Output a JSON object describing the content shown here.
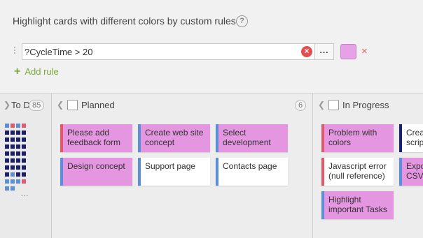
{
  "rules_panel": {
    "title": "Highlight cards with different colors by custom rules",
    "help_glyph": "?",
    "rule": {
      "expression": "?CycleTime > 20",
      "clear_glyph": "×",
      "more_label": "...",
      "swatch_color": "#e7a1e7",
      "remove_glyph": "×"
    },
    "add_rule_plus": "+",
    "add_rule_label": "Add rule"
  },
  "colors": {
    "card_highlight": "#e496e0",
    "card_plain": "#ffffff",
    "bar_blue": "#5b8fd8",
    "bar_red": "#e05a6a",
    "bar_navy": "#1b1f6b",
    "add_green": "#7aaa3a"
  },
  "board": {
    "columns": [
      {
        "id": "todo",
        "title": "To D",
        "count": "85",
        "collapsed": true,
        "more_label": "..."
      },
      {
        "id": "planned",
        "title": "Planned",
        "count": "6",
        "cards": [
          {
            "text": "Please add feedback form",
            "highlight": true,
            "bar": "red"
          },
          {
            "text": "Create web site concept",
            "highlight": true,
            "bar": "blue"
          },
          {
            "text": "Select development",
            "highlight": true,
            "bar": "blue"
          },
          {
            "text": "Design concept",
            "highlight": true,
            "bar": "blue"
          },
          {
            "text": "Support page",
            "highlight": false,
            "bar": "blue"
          },
          {
            "text": "Contacts page",
            "highlight": false,
            "bar": "blue"
          }
        ]
      },
      {
        "id": "in-progress",
        "title": "In Progress",
        "cards": [
          {
            "text": "Problem with colors",
            "highlight": true,
            "bar": "red"
          },
          {
            "text": "Creat script",
            "highlight": false,
            "bar": "navy"
          },
          {
            "text": "Javascript error (null reference)",
            "highlight": false,
            "bar": "red"
          },
          {
            "text": "Expo CSV",
            "highlight": true,
            "bar": "blue"
          },
          {
            "text": "Highlight important Tasks",
            "highlight": true,
            "bar": "blue"
          }
        ]
      }
    ]
  }
}
